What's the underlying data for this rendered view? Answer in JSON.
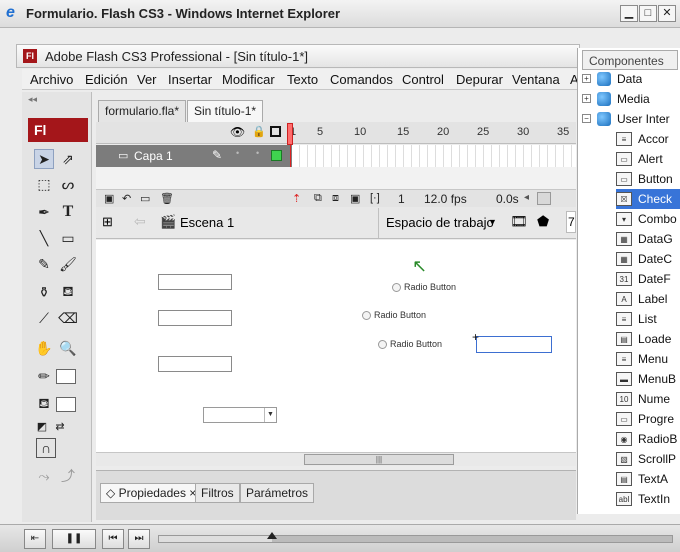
{
  "ie": {
    "title": "Formulario. Flash CS3 - Windows Internet Explorer",
    "minimize": "▁",
    "maximize": "□",
    "close": "✕"
  },
  "flash": {
    "title": "Adobe Flash CS3 Professional - [Sin título-1*]",
    "logo_small": "Fl",
    "logo": "Fl",
    "menu": [
      "Archivo",
      "Edición",
      "Ver",
      "Insertar",
      "Modificar",
      "Texto",
      "Comandos",
      "Control",
      "Depurar",
      "Ventana",
      "A"
    ],
    "doc_tabs": [
      "formulario.fla*",
      "Sin título-1*"
    ],
    "timeline": {
      "frame_numbers": [
        "1",
        "5",
        "10",
        "15",
        "20",
        "25",
        "30",
        "35"
      ],
      "layer_name": "Capa 1",
      "current_frame": "1",
      "fps": "12.0 fps",
      "time": "0.0s"
    },
    "scene_label": "Escena 1",
    "workspace_label": "Espacio de trabajo",
    "zoom_fragment": "7",
    "stage": {
      "radio_labels": [
        "Radio Button",
        "Radio Button",
        "Radio Button"
      ]
    },
    "scroll_grip": "|||",
    "props_tabs": [
      "Propiedades",
      "Filtros",
      "Parámetros"
    ],
    "props_close": "×"
  },
  "components": {
    "header": "Componentes",
    "categories": [
      "Data",
      "Media",
      "User Inter"
    ],
    "items": [
      {
        "label": "Accor",
        "icon": "accordion-icon",
        "glyph": "≡"
      },
      {
        "label": "Alert",
        "icon": "alert-icon",
        "glyph": "▭"
      },
      {
        "label": "Button",
        "icon": "button-icon",
        "glyph": "▭"
      },
      {
        "label": "Check",
        "icon": "checkbox-icon",
        "glyph": "☒"
      },
      {
        "label": "Combo",
        "icon": "combobox-icon",
        "glyph": "▾"
      },
      {
        "label": "DataG",
        "icon": "datagrid-icon",
        "glyph": "▦"
      },
      {
        "label": "DateC",
        "icon": "datechooser-icon",
        "glyph": "▦"
      },
      {
        "label": "DateF",
        "icon": "datefield-icon",
        "glyph": "31"
      },
      {
        "label": "Label",
        "icon": "label-icon",
        "glyph": "A"
      },
      {
        "label": "List",
        "icon": "list-icon",
        "glyph": "≡"
      },
      {
        "label": "Loade",
        "icon": "loader-icon",
        "glyph": "▤"
      },
      {
        "label": "Menu",
        "icon": "menu-icon",
        "glyph": "≡"
      },
      {
        "label": "MenuB",
        "icon": "menubar-icon",
        "glyph": "▬"
      },
      {
        "label": "Nume",
        "icon": "numericstepper-icon",
        "glyph": "10"
      },
      {
        "label": "Progre",
        "icon": "progressbar-icon",
        "glyph": "▭"
      },
      {
        "label": "RadioB",
        "icon": "radiobutton-icon",
        "glyph": "◉"
      },
      {
        "label": "ScrollP",
        "icon": "scrollpane-icon",
        "glyph": "▧"
      },
      {
        "label": "TextA",
        "icon": "textarea-icon",
        "glyph": "▤"
      },
      {
        "label": "TextIn",
        "icon": "textinput-icon",
        "glyph": "abl"
      }
    ]
  },
  "video": {
    "buttons": [
      "⇤",
      "❚❚",
      "⏮",
      "⏭"
    ],
    "progress_fraction": 0.22
  }
}
